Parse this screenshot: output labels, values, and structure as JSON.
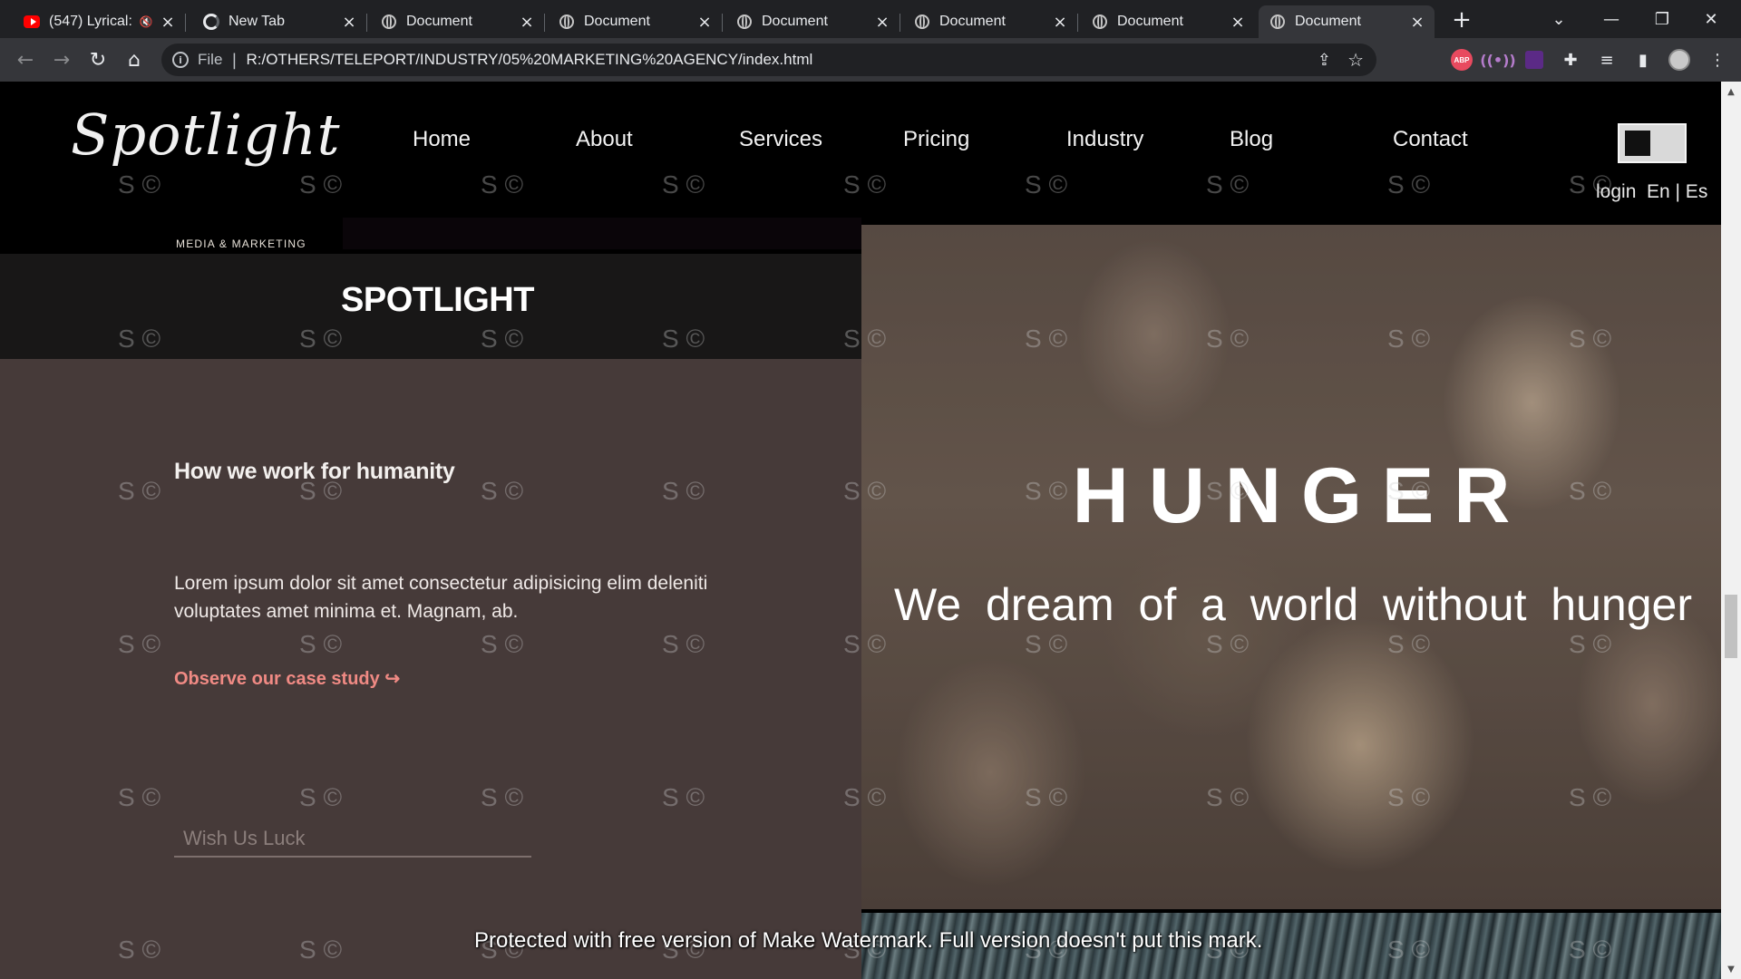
{
  "browser": {
    "tabs": [
      {
        "title": "(547) Lyrical: ",
        "icon": "youtube-icon",
        "muted": true
      },
      {
        "title": "New Tab",
        "icon": "chrome-icon"
      },
      {
        "title": "Document",
        "icon": "globe-icon"
      },
      {
        "title": "Document",
        "icon": "globe-icon"
      },
      {
        "title": "Document",
        "icon": "globe-icon"
      },
      {
        "title": "Document",
        "icon": "globe-icon"
      },
      {
        "title": "Document",
        "icon": "globe-icon"
      },
      {
        "title": "Document",
        "icon": "globe-icon",
        "active": true
      }
    ],
    "address": {
      "scheme": "File",
      "url": "R:/OTHERS/TELEPORT/INDUSTRY/05%20MARKETING%20AGENCY/index.html"
    },
    "extensions": {
      "abp_label": "ABP"
    }
  },
  "site": {
    "logo": {
      "script": "Spotlight",
      "sub": "MEDIA & MARKETING"
    },
    "nav": [
      "Home",
      "About",
      "Services",
      "Pricing",
      "Industry",
      "Blog",
      "Contact"
    ],
    "login": "login",
    "lang": "En | Es",
    "band_title": "SPOTLIGHT",
    "section": {
      "heading": "How we work for humanity",
      "body": "Lorem ipsum dolor sit amet consectetur adipisicing elim deleniti voluptates amet minima et. Magnam, ab.",
      "link": "Observe our case study ↪",
      "input_placeholder": "Wish Us Luck"
    },
    "hero": {
      "title": "HUNGER",
      "subtitle": "We dream of a world without hunger"
    },
    "watermark_mark": "S ©",
    "watermark_banner": "Protected with free version of Make Watermark. Full version doesn't put this mark."
  },
  "colors": {
    "tabstrip": "#202124",
    "toolbar": "#35363a",
    "page_bg": "#000000",
    "band_bg": "#181717",
    "panel_bg": "#463a39",
    "link": "#f08a84"
  }
}
